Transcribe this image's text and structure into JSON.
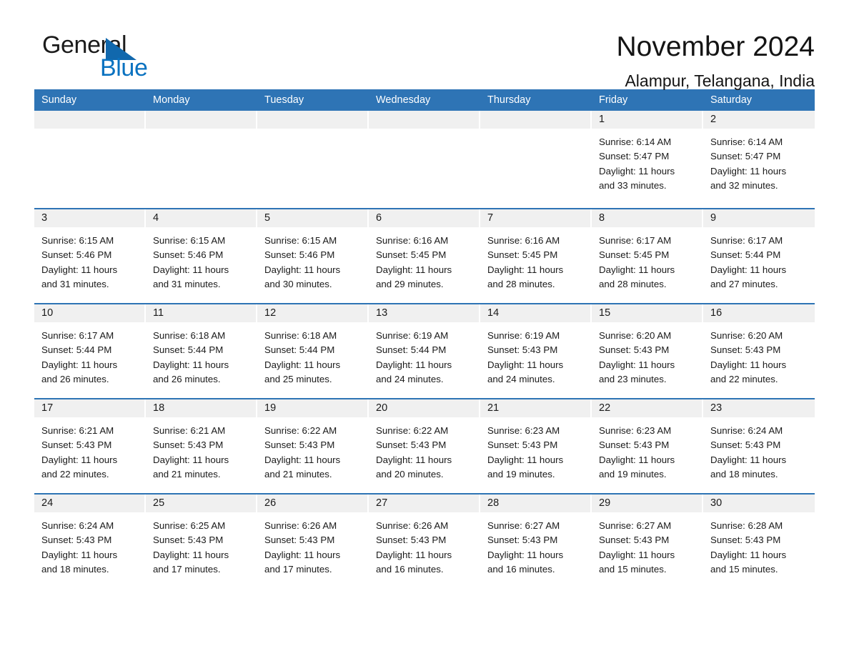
{
  "brand": {
    "word1": "General",
    "word2": "Blue",
    "mark": "triangle-logo",
    "accent_blue": "#0a72c0"
  },
  "header": {
    "title": "November 2024",
    "subtitle": "Alampur, Telangana, India"
  },
  "theme": {
    "header_blue": "#2e74b5",
    "cell_head_gray": "#f0f0f0",
    "text": "#1a1a1a"
  },
  "weekdays": [
    "Sunday",
    "Monday",
    "Tuesday",
    "Wednesday",
    "Thursday",
    "Friday",
    "Saturday"
  ],
  "weeks": [
    [
      {
        "day": "",
        "lines": []
      },
      {
        "day": "",
        "lines": []
      },
      {
        "day": "",
        "lines": []
      },
      {
        "day": "",
        "lines": []
      },
      {
        "day": "",
        "lines": []
      },
      {
        "day": "1",
        "lines": [
          "Sunrise: 6:14 AM",
          "Sunset: 5:47 PM",
          "Daylight: 11 hours",
          "and 33 minutes."
        ]
      },
      {
        "day": "2",
        "lines": [
          "Sunrise: 6:14 AM",
          "Sunset: 5:47 PM",
          "Daylight: 11 hours",
          "and 32 minutes."
        ]
      }
    ],
    [
      {
        "day": "3",
        "lines": [
          "Sunrise: 6:15 AM",
          "Sunset: 5:46 PM",
          "Daylight: 11 hours",
          "and 31 minutes."
        ]
      },
      {
        "day": "4",
        "lines": [
          "Sunrise: 6:15 AM",
          "Sunset: 5:46 PM",
          "Daylight: 11 hours",
          "and 31 minutes."
        ]
      },
      {
        "day": "5",
        "lines": [
          "Sunrise: 6:15 AM",
          "Sunset: 5:46 PM",
          "Daylight: 11 hours",
          "and 30 minutes."
        ]
      },
      {
        "day": "6",
        "lines": [
          "Sunrise: 6:16 AM",
          "Sunset: 5:45 PM",
          "Daylight: 11 hours",
          "and 29 minutes."
        ]
      },
      {
        "day": "7",
        "lines": [
          "Sunrise: 6:16 AM",
          "Sunset: 5:45 PM",
          "Daylight: 11 hours",
          "and 28 minutes."
        ]
      },
      {
        "day": "8",
        "lines": [
          "Sunrise: 6:17 AM",
          "Sunset: 5:45 PM",
          "Daylight: 11 hours",
          "and 28 minutes."
        ]
      },
      {
        "day": "9",
        "lines": [
          "Sunrise: 6:17 AM",
          "Sunset: 5:44 PM",
          "Daylight: 11 hours",
          "and 27 minutes."
        ]
      }
    ],
    [
      {
        "day": "10",
        "lines": [
          "Sunrise: 6:17 AM",
          "Sunset: 5:44 PM",
          "Daylight: 11 hours",
          "and 26 minutes."
        ]
      },
      {
        "day": "11",
        "lines": [
          "Sunrise: 6:18 AM",
          "Sunset: 5:44 PM",
          "Daylight: 11 hours",
          "and 26 minutes."
        ]
      },
      {
        "day": "12",
        "lines": [
          "Sunrise: 6:18 AM",
          "Sunset: 5:44 PM",
          "Daylight: 11 hours",
          "and 25 minutes."
        ]
      },
      {
        "day": "13",
        "lines": [
          "Sunrise: 6:19 AM",
          "Sunset: 5:44 PM",
          "Daylight: 11 hours",
          "and 24 minutes."
        ]
      },
      {
        "day": "14",
        "lines": [
          "Sunrise: 6:19 AM",
          "Sunset: 5:43 PM",
          "Daylight: 11 hours",
          "and 24 minutes."
        ]
      },
      {
        "day": "15",
        "lines": [
          "Sunrise: 6:20 AM",
          "Sunset: 5:43 PM",
          "Daylight: 11 hours",
          "and 23 minutes."
        ]
      },
      {
        "day": "16",
        "lines": [
          "Sunrise: 6:20 AM",
          "Sunset: 5:43 PM",
          "Daylight: 11 hours",
          "and 22 minutes."
        ]
      }
    ],
    [
      {
        "day": "17",
        "lines": [
          "Sunrise: 6:21 AM",
          "Sunset: 5:43 PM",
          "Daylight: 11 hours",
          "and 22 minutes."
        ]
      },
      {
        "day": "18",
        "lines": [
          "Sunrise: 6:21 AM",
          "Sunset: 5:43 PM",
          "Daylight: 11 hours",
          "and 21 minutes."
        ]
      },
      {
        "day": "19",
        "lines": [
          "Sunrise: 6:22 AM",
          "Sunset: 5:43 PM",
          "Daylight: 11 hours",
          "and 21 minutes."
        ]
      },
      {
        "day": "20",
        "lines": [
          "Sunrise: 6:22 AM",
          "Sunset: 5:43 PM",
          "Daylight: 11 hours",
          "and 20 minutes."
        ]
      },
      {
        "day": "21",
        "lines": [
          "Sunrise: 6:23 AM",
          "Sunset: 5:43 PM",
          "Daylight: 11 hours",
          "and 19 minutes."
        ]
      },
      {
        "day": "22",
        "lines": [
          "Sunrise: 6:23 AM",
          "Sunset: 5:43 PM",
          "Daylight: 11 hours",
          "and 19 minutes."
        ]
      },
      {
        "day": "23",
        "lines": [
          "Sunrise: 6:24 AM",
          "Sunset: 5:43 PM",
          "Daylight: 11 hours",
          "and 18 minutes."
        ]
      }
    ],
    [
      {
        "day": "24",
        "lines": [
          "Sunrise: 6:24 AM",
          "Sunset: 5:43 PM",
          "Daylight: 11 hours",
          "and 18 minutes."
        ]
      },
      {
        "day": "25",
        "lines": [
          "Sunrise: 6:25 AM",
          "Sunset: 5:43 PM",
          "Daylight: 11 hours",
          "and 17 minutes."
        ]
      },
      {
        "day": "26",
        "lines": [
          "Sunrise: 6:26 AM",
          "Sunset: 5:43 PM",
          "Daylight: 11 hours",
          "and 17 minutes."
        ]
      },
      {
        "day": "27",
        "lines": [
          "Sunrise: 6:26 AM",
          "Sunset: 5:43 PM",
          "Daylight: 11 hours",
          "and 16 minutes."
        ]
      },
      {
        "day": "28",
        "lines": [
          "Sunrise: 6:27 AM",
          "Sunset: 5:43 PM",
          "Daylight: 11 hours",
          "and 16 minutes."
        ]
      },
      {
        "day": "29",
        "lines": [
          "Sunrise: 6:27 AM",
          "Sunset: 5:43 PM",
          "Daylight: 11 hours",
          "and 15 minutes."
        ]
      },
      {
        "day": "30",
        "lines": [
          "Sunrise: 6:28 AM",
          "Sunset: 5:43 PM",
          "Daylight: 11 hours",
          "and 15 minutes."
        ]
      }
    ]
  ]
}
